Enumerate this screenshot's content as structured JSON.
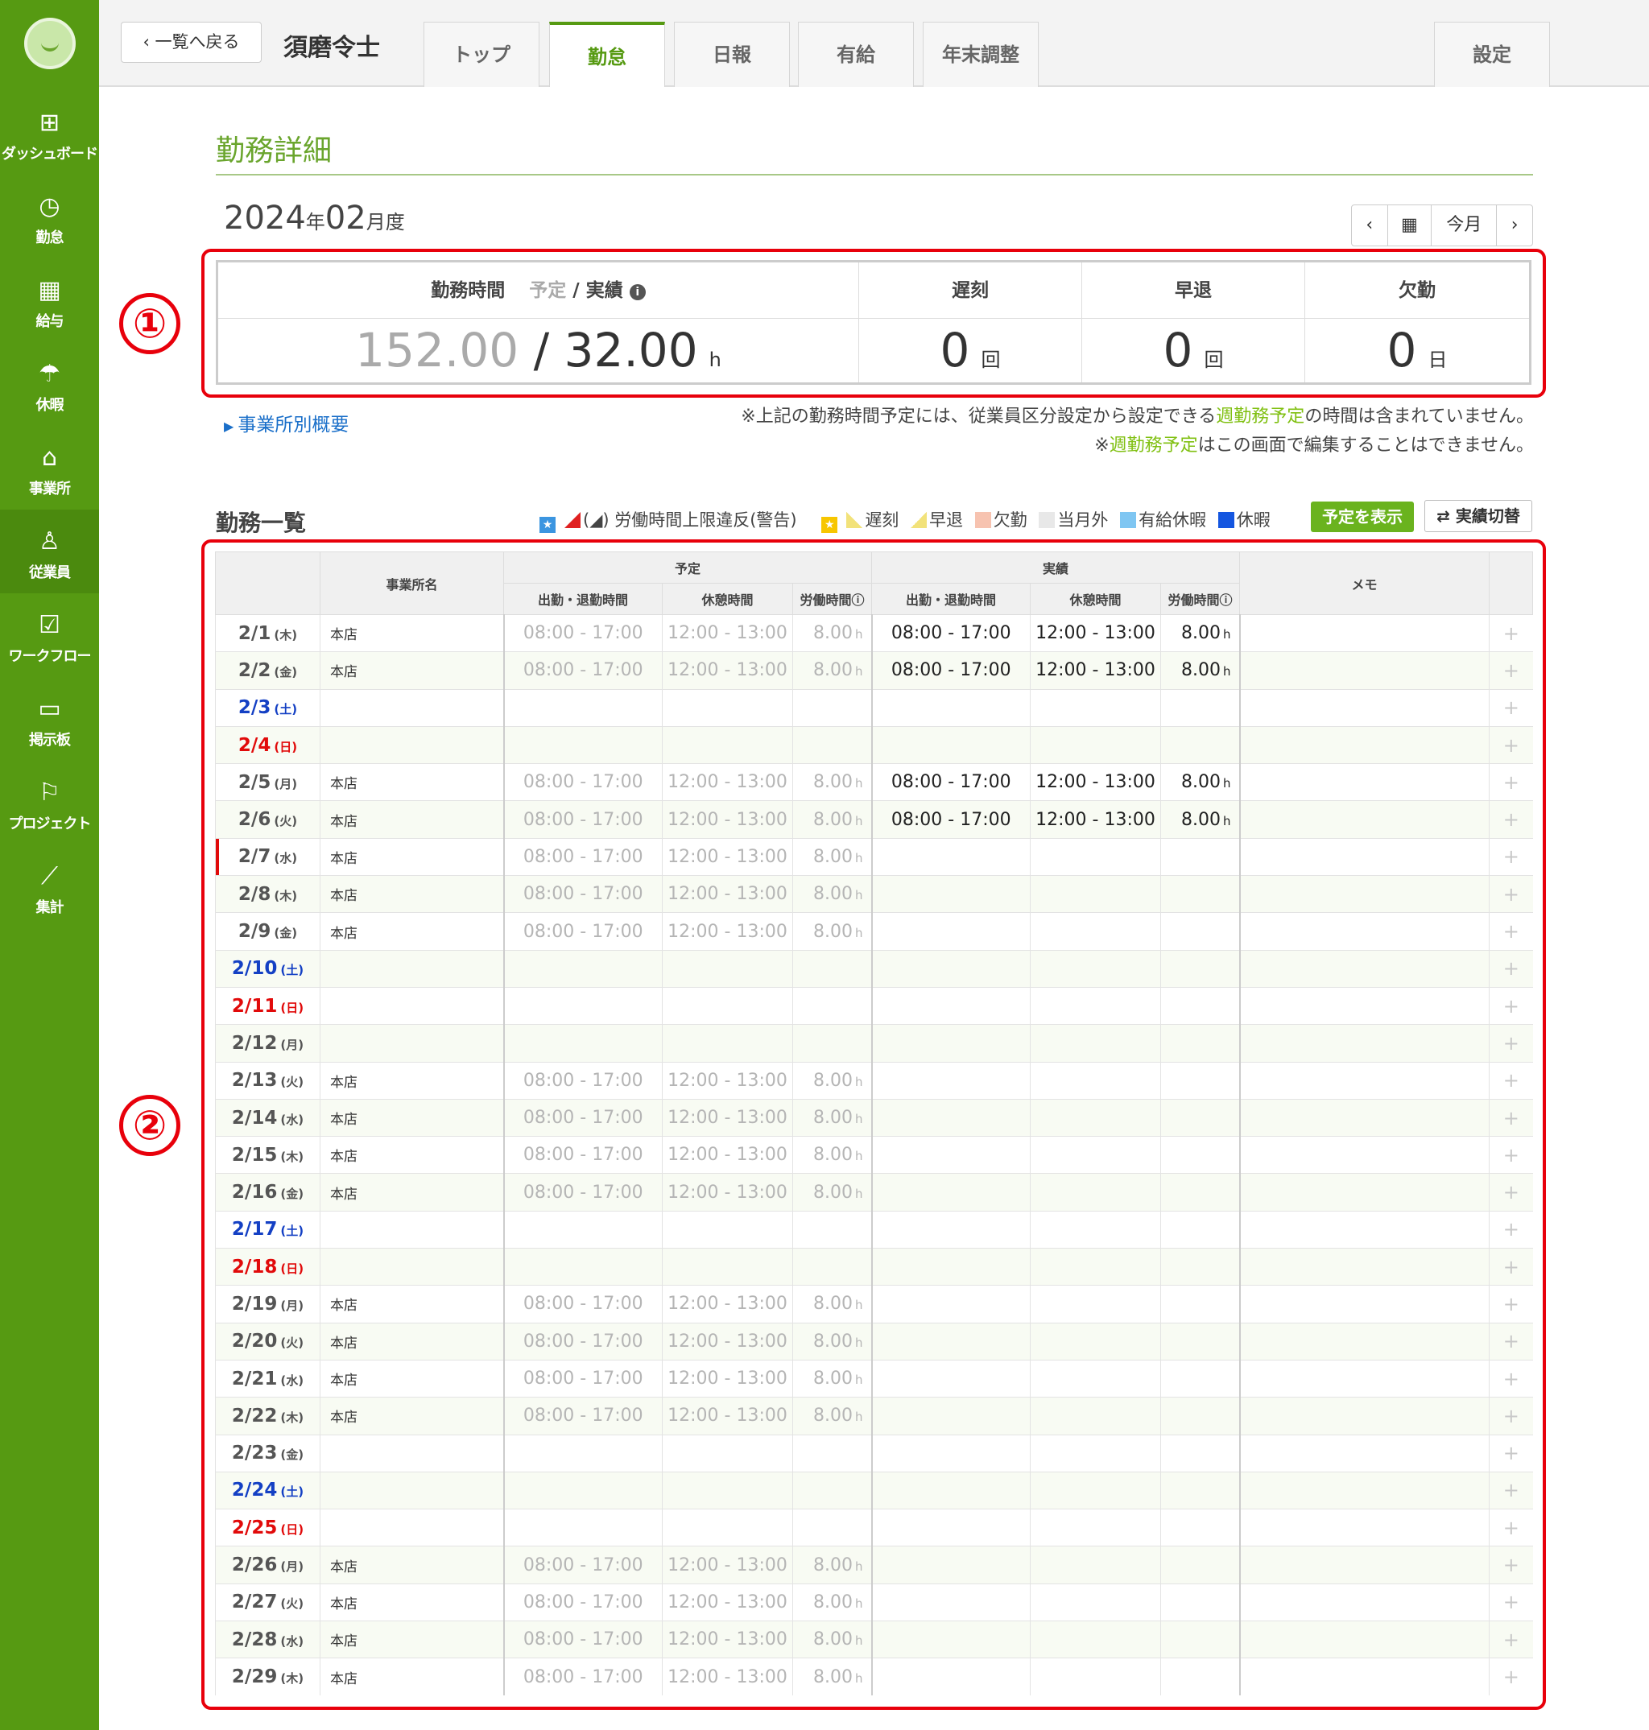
{
  "sidebar": {
    "items": [
      {
        "label": "ダッシュボード",
        "icon": "dashboard-icon"
      },
      {
        "label": "勤怠",
        "icon": "clock-icon"
      },
      {
        "label": "給与",
        "icon": "calculator-icon"
      },
      {
        "label": "休暇",
        "icon": "umbrella-icon"
      },
      {
        "label": "事業所",
        "icon": "home-icon"
      },
      {
        "label": "従業員",
        "icon": "person-icon",
        "active": true
      },
      {
        "label": "ワークフロー",
        "icon": "checklist-icon"
      },
      {
        "label": "掲示板",
        "icon": "chat-icon"
      },
      {
        "label": "プロジェクト",
        "icon": "flag-icon"
      },
      {
        "label": "集計",
        "icon": "line-chart-icon"
      }
    ]
  },
  "header": {
    "back_label": "一覧へ戻る",
    "employee_name": "須磨令士",
    "tabs": [
      {
        "label": "トップ"
      },
      {
        "label": "勤怠",
        "active": true
      },
      {
        "label": "日報"
      },
      {
        "label": "有給"
      },
      {
        "label": "年末調整"
      }
    ],
    "settings_label": "設定"
  },
  "detail": {
    "title": "勤務詳細",
    "year": "2024",
    "year_suffix": "年",
    "month": "02",
    "month_suffix": "月度",
    "today_label": "今月"
  },
  "summary": {
    "work_time_label": "勤務時間",
    "plan_label": "予定",
    "actual_label": "/ 実績",
    "plan_hours": "152.00",
    "slash": "/",
    "actual_hours": "32.00",
    "hours_unit": "h",
    "late_label": "遅刻",
    "late_count": "0",
    "late_unit": "回",
    "early_label": "早退",
    "early_count": "0",
    "early_unit": "回",
    "absent_label": "欠勤",
    "absent_count": "0",
    "absent_unit": "日"
  },
  "annotations": {
    "one": "①",
    "two": "②"
  },
  "office_link": "事業所別概要",
  "notes": {
    "line1_a": "※上記の勤務時間予定には、従業員区分設定から設定できる",
    "line1_hl": "週勤務予定",
    "line1_b": "の時間は含まれていません。",
    "line2_a": "※",
    "line2_hl": "週勤務予定",
    "line2_b": "はこの画面で編集することはできません。"
  },
  "list": {
    "title": "勤務一覧",
    "legend": {
      "violation": "労働時間上限違反(警告)",
      "late": "遅刻",
      "early": "早退",
      "absent": "欠勤",
      "out_of_month": "当月外",
      "paid_leave": "有給休暇",
      "holiday": "休暇"
    },
    "show_plan_label": "予定を表示",
    "switch_label": "⇄ 実績切替",
    "headers": {
      "office": "事業所名",
      "plan": "予定",
      "actual": "実績",
      "memo": "メモ",
      "clock": "出勤・退勤時間",
      "break": "休憩時間",
      "labor": "労働時間"
    }
  },
  "colors": {
    "sidebar": "#569a12",
    "accent": "#6aa52d",
    "saturday": "#1440c4",
    "sunday": "#e10a0a",
    "annotation": "#e8000b"
  },
  "rows": [
    {
      "date": "2/1",
      "dow": "(木)",
      "office": "本店",
      "p_clock": "08:00 - 17:00",
      "p_break": "12:00 - 13:00",
      "p_hours": "8.00",
      "a_clock": "08:00 - 17:00",
      "a_break": "12:00 - 13:00",
      "a_hours": "8.00"
    },
    {
      "date": "2/2",
      "dow": "(金)",
      "office": "本店",
      "p_clock": "08:00 - 17:00",
      "p_break": "12:00 - 13:00",
      "p_hours": "8.00",
      "a_clock": "08:00 - 17:00",
      "a_break": "12:00 - 13:00",
      "a_hours": "8.00"
    },
    {
      "date": "2/3",
      "dow": "(土)",
      "type": "sat"
    },
    {
      "date": "2/4",
      "dow": "(日)",
      "type": "sun"
    },
    {
      "date": "2/5",
      "dow": "(月)",
      "office": "本店",
      "p_clock": "08:00 - 17:00",
      "p_break": "12:00 - 13:00",
      "p_hours": "8.00",
      "a_clock": "08:00 - 17:00",
      "a_break": "12:00 - 13:00",
      "a_hours": "8.00"
    },
    {
      "date": "2/6",
      "dow": "(火)",
      "office": "本店",
      "p_clock": "08:00 - 17:00",
      "p_break": "12:00 - 13:00",
      "p_hours": "8.00",
      "a_clock": "08:00 - 17:00",
      "a_break": "12:00 - 13:00",
      "a_hours": "8.00"
    },
    {
      "date": "2/7",
      "dow": "(水)",
      "office": "本店",
      "p_clock": "08:00 - 17:00",
      "p_break": "12:00 - 13:00",
      "p_hours": "8.00",
      "today": true
    },
    {
      "date": "2/8",
      "dow": "(木)",
      "office": "本店",
      "p_clock": "08:00 - 17:00",
      "p_break": "12:00 - 13:00",
      "p_hours": "8.00"
    },
    {
      "date": "2/9",
      "dow": "(金)",
      "office": "本店",
      "p_clock": "08:00 - 17:00",
      "p_break": "12:00 - 13:00",
      "p_hours": "8.00"
    },
    {
      "date": "2/10",
      "dow": "(土)",
      "type": "sat"
    },
    {
      "date": "2/11",
      "dow": "(日)",
      "type": "sun"
    },
    {
      "date": "2/12",
      "dow": "(月)"
    },
    {
      "date": "2/13",
      "dow": "(火)",
      "office": "本店",
      "p_clock": "08:00 - 17:00",
      "p_break": "12:00 - 13:00",
      "p_hours": "8.00"
    },
    {
      "date": "2/14",
      "dow": "(水)",
      "office": "本店",
      "p_clock": "08:00 - 17:00",
      "p_break": "12:00 - 13:00",
      "p_hours": "8.00"
    },
    {
      "date": "2/15",
      "dow": "(木)",
      "office": "本店",
      "p_clock": "08:00 - 17:00",
      "p_break": "12:00 - 13:00",
      "p_hours": "8.00"
    },
    {
      "date": "2/16",
      "dow": "(金)",
      "office": "本店",
      "p_clock": "08:00 - 17:00",
      "p_break": "12:00 - 13:00",
      "p_hours": "8.00"
    },
    {
      "date": "2/17",
      "dow": "(土)",
      "type": "sat"
    },
    {
      "date": "2/18",
      "dow": "(日)",
      "type": "sun"
    },
    {
      "date": "2/19",
      "dow": "(月)",
      "office": "本店",
      "p_clock": "08:00 - 17:00",
      "p_break": "12:00 - 13:00",
      "p_hours": "8.00"
    },
    {
      "date": "2/20",
      "dow": "(火)",
      "office": "本店",
      "p_clock": "08:00 - 17:00",
      "p_break": "12:00 - 13:00",
      "p_hours": "8.00"
    },
    {
      "date": "2/21",
      "dow": "(水)",
      "office": "本店",
      "p_clock": "08:00 - 17:00",
      "p_break": "12:00 - 13:00",
      "p_hours": "8.00"
    },
    {
      "date": "2/22",
      "dow": "(木)",
      "office": "本店",
      "p_clock": "08:00 - 17:00",
      "p_break": "12:00 - 13:00",
      "p_hours": "8.00"
    },
    {
      "date": "2/23",
      "dow": "(金)"
    },
    {
      "date": "2/24",
      "dow": "(土)",
      "type": "sat"
    },
    {
      "date": "2/25",
      "dow": "(日)",
      "type": "sun"
    },
    {
      "date": "2/26",
      "dow": "(月)",
      "office": "本店",
      "p_clock": "08:00 - 17:00",
      "p_break": "12:00 - 13:00",
      "p_hours": "8.00"
    },
    {
      "date": "2/27",
      "dow": "(火)",
      "office": "本店",
      "p_clock": "08:00 - 17:00",
      "p_break": "12:00 - 13:00",
      "p_hours": "8.00"
    },
    {
      "date": "2/28",
      "dow": "(水)",
      "office": "本店",
      "p_clock": "08:00 - 17:00",
      "p_break": "12:00 - 13:00",
      "p_hours": "8.00"
    },
    {
      "date": "2/29",
      "dow": "(木)",
      "office": "本店",
      "p_clock": "08:00 - 17:00",
      "p_break": "12:00 - 13:00",
      "p_hours": "8.00"
    }
  ],
  "hours_unit": "h",
  "add_symbol": "+"
}
